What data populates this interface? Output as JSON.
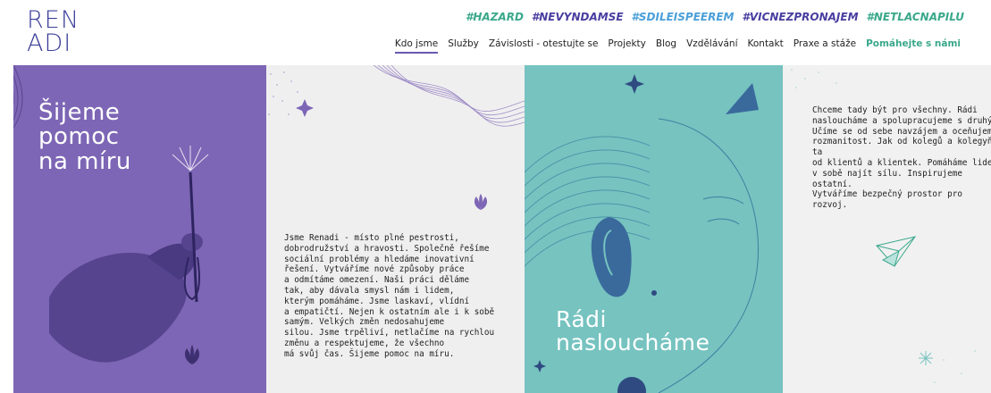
{
  "logo": {
    "line1": "REN",
    "line2": "ADI"
  },
  "hashtags": [
    {
      "text": "#HAZARD",
      "color": "#3aa88b"
    },
    {
      "text": "#NEVYNDAMSE",
      "color": "#4a3ea0"
    },
    {
      "text": "#SDILEISPEEREM",
      "color": "#4a9fd8"
    },
    {
      "text": "#VICNEZPRONAJEM",
      "color": "#4a3ea0"
    },
    {
      "text": "#NETLACNAPILU",
      "color": "#3aa88b"
    }
  ],
  "nav": {
    "items": [
      "Kdo jsme",
      "Služby",
      "Závislosti - otestujte se",
      "Projekty",
      "Blog",
      "Vzdělávání",
      "Kontakt",
      "Praxe a stáže"
    ],
    "cta": "Pomáhejte s námi",
    "active_index": 0
  },
  "panels": {
    "p1": {
      "headline": [
        "Šijeme",
        "pomoc",
        "na míru"
      ],
      "color": "#7d66b5"
    },
    "p2": {
      "text": [
        "Jsme Renadi - místo plné pestrosti,",
        "dobrodružství a hravosti. Společně řešíme",
        "sociální problémy a hledáme inovativní",
        "řešení. Vytváříme nové způsoby práce",
        "a odmítáme omezení. Naši práci děláme",
        "tak, aby dávala smysl nám i lidem,",
        "kterým pomáháme. Jsme laskaví, vlídní",
        "a empatičtí. Nejen k ostatním ale i k sobě",
        "samým. Velkých změn nedosahujeme",
        "silou. Jsme trpěliví, netlačíme na rychlou",
        "změnu a respektujeme, že všechno",
        "má svůj čas. Šijeme pomoc na míru."
      ]
    },
    "p3": {
      "headline": [
        "Rádi",
        "nasloucháme"
      ],
      "color": "#76c3c0"
    },
    "p4": {
      "text": [
        "Chceme tady být pro všechny. Rádi",
        "nasloucháme a spolupracujeme s druhý",
        "Učíme se od sebe navzájem a oceňujem",
        "rozmanitost. Jak od kolegů a kolegyň, ta",
        "od klientů a klientek. Pomáháme lidem",
        "v sobě najít sílu. Inspirujeme ostatní.",
        "Vytváříme bezpečný prostor pro rozvoj."
      ]
    }
  }
}
